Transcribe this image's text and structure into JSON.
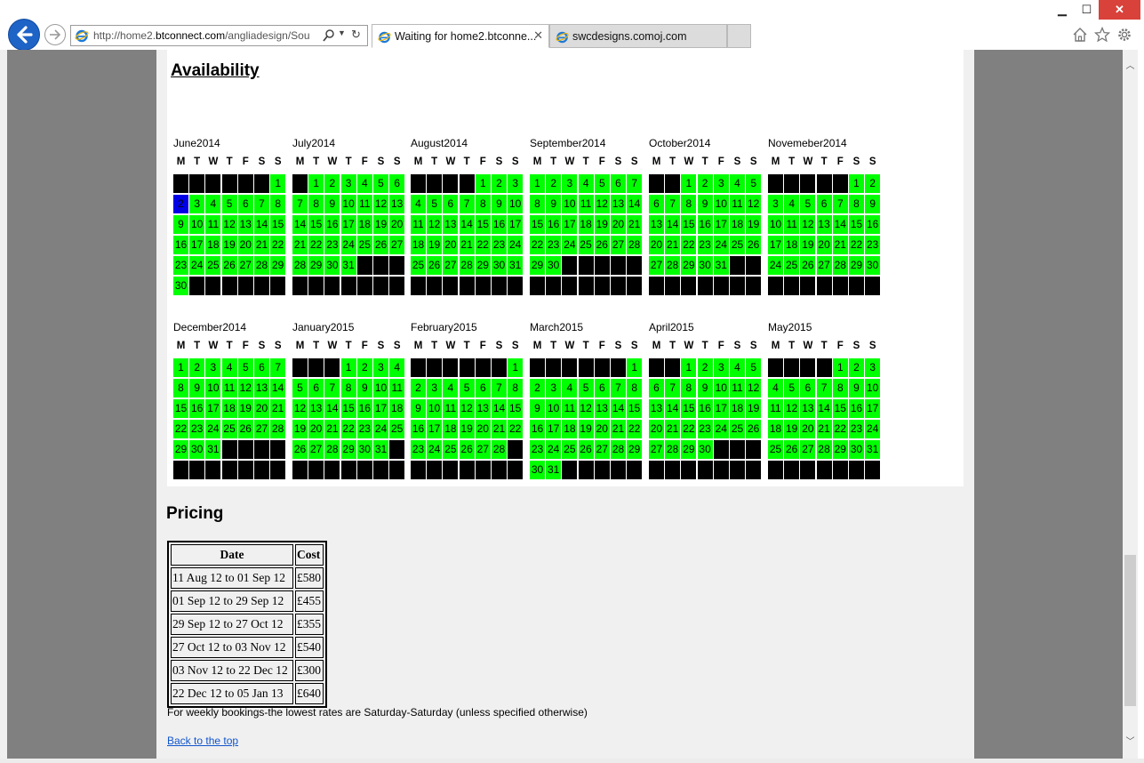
{
  "browser": {
    "address_prefix": "http://home2.",
    "address_domain": "btconnect.com",
    "address_suffix": "/angliadesign/Sou",
    "tabs": [
      {
        "label": "Waiting for home2.btconne...",
        "active": true
      },
      {
        "label": "swcdesigns.comoj.com",
        "active": false
      }
    ],
    "window_controls": {
      "minimize": "▁",
      "maximize": "☐",
      "close": "✕"
    }
  },
  "page": {
    "availability_heading": "Availability",
    "pricing_heading": "Pricing",
    "weekday_headers": [
      "M",
      "T",
      "W",
      "T",
      "F",
      "S",
      "S"
    ],
    "months": [
      {
        "title": "June2014",
        "offset": 6,
        "days": 30
      },
      {
        "title": "July2014",
        "offset": 1,
        "days": 31
      },
      {
        "title": "August2014",
        "offset": 4,
        "days": 31
      },
      {
        "title": "September2014",
        "offset": 0,
        "days": 30
      },
      {
        "title": "October2014",
        "offset": 2,
        "days": 31
      },
      {
        "title": "Novemeber2014",
        "offset": 5,
        "days": 30
      },
      {
        "title": "December2014",
        "offset": 0,
        "days": 31
      },
      {
        "title": "January2015",
        "offset": 3,
        "days": 31
      },
      {
        "title": "February2015",
        "offset": 6,
        "days": 28
      },
      {
        "title": "March2015",
        "offset": 6,
        "days": 31
      },
      {
        "title": "April2015",
        "offset": 2,
        "days": 30
      },
      {
        "title": "May2015",
        "offset": 4,
        "days": 31
      }
    ],
    "highlighted_day": {
      "month": "June2014",
      "day": 2
    },
    "pricing_table": {
      "headers": [
        "Date",
        "Cost"
      ],
      "rows": [
        [
          "11 Aug 12 to 01 Sep 12",
          "£580"
        ],
        [
          "01 Sep 12 to 29 Sep 12",
          "£455"
        ],
        [
          "29 Sep 12 to 27 Oct 12",
          "£355"
        ],
        [
          "27 Oct 12 to 03 Nov 12",
          "£540"
        ],
        [
          "03 Nov 12 to 22 Dec 12",
          "£300"
        ],
        [
          "22 Dec 12 to 05 Jan 13",
          "£640"
        ]
      ]
    },
    "weekly_note": "For weekly bookings-the lowest rates are Saturday-Saturday (unless specified otherwise)",
    "back_to_top": "Back to the top"
  },
  "colors": {
    "available": "#00ff00",
    "unavailable": "#000000",
    "selected": "#0000e6",
    "link": "#1155cc"
  }
}
